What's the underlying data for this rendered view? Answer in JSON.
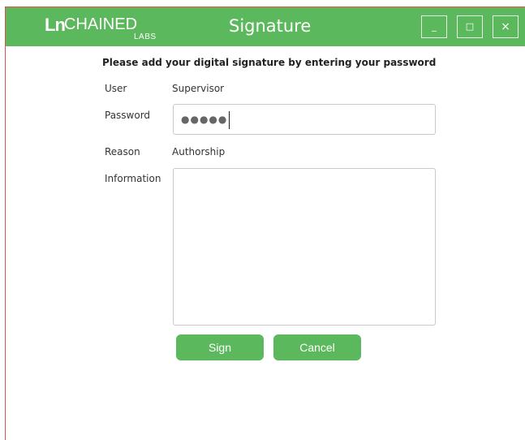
{
  "logo": {
    "mark": "Ln",
    "main": "CHAINED",
    "sub": "LABS"
  },
  "window": {
    "title": "Signature",
    "controls": {
      "minimize": "_",
      "maximize": "□",
      "close": "×"
    }
  },
  "form": {
    "heading": "Please add your digital signature by entering your password",
    "user_label": "User",
    "user_value": "Supervisor",
    "password_label": "Password",
    "password_mask": "●●●●●",
    "reason_label": "Reason",
    "reason_value": "Authorship",
    "information_label": "Information",
    "information_value": ""
  },
  "buttons": {
    "sign": "Sign",
    "cancel": "Cancel"
  },
  "colors": {
    "accent": "#5cb85c",
    "border": "#d9534f"
  }
}
